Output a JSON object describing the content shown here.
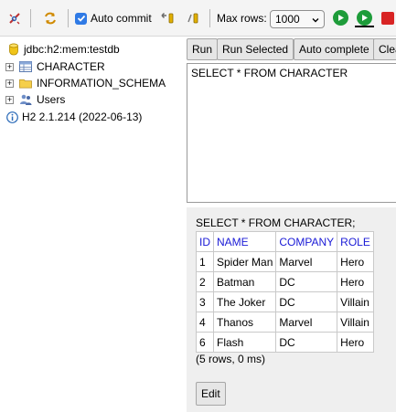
{
  "toolbar": {
    "auto_commit_label": "Auto commit",
    "auto_commit_checked": true,
    "max_rows_label": "Max rows:",
    "max_rows_value": "1000",
    "icons": [
      "disconnect-icon",
      "refresh-icon",
      "rollback-icon",
      "commit-icon",
      "run-icon",
      "run-selected-icon",
      "stop-icon"
    ]
  },
  "tree": {
    "connection": "jdbc:h2:mem:testdb",
    "items": [
      {
        "label": "CHARACTER",
        "icon": "table-icon"
      },
      {
        "label": "INFORMATION_SCHEMA",
        "icon": "folder-icon"
      },
      {
        "label": "Users",
        "icon": "users-icon"
      }
    ],
    "version": "H2 2.1.214 (2022-06-13)"
  },
  "buttons": {
    "run": "Run",
    "run_selected": "Run Selected",
    "auto_complete": "Auto complete",
    "clear": "Clear"
  },
  "editor": {
    "sql": "SELECT * FROM CHARACTER"
  },
  "result": {
    "sql": "SELECT * FROM CHARACTER;",
    "columns": [
      "ID",
      "NAME",
      "COMPANY",
      "ROLE"
    ],
    "rows": [
      [
        "1",
        "Spider Man",
        "Marvel",
        "Hero"
      ],
      [
        "2",
        "Batman",
        "DC",
        "Hero"
      ],
      [
        "3",
        "The Joker",
        "DC",
        "Villain"
      ],
      [
        "4",
        "Thanos",
        "Marvel",
        "Villain"
      ],
      [
        "6",
        "Flash",
        "DC",
        "Hero"
      ]
    ],
    "row_count": "(5 rows, 0 ms)",
    "edit_label": "Edit"
  },
  "colors": {
    "header_link": "#1a1ad6",
    "result_bg": "#efefef",
    "checkbox": "#2f7ae5"
  }
}
